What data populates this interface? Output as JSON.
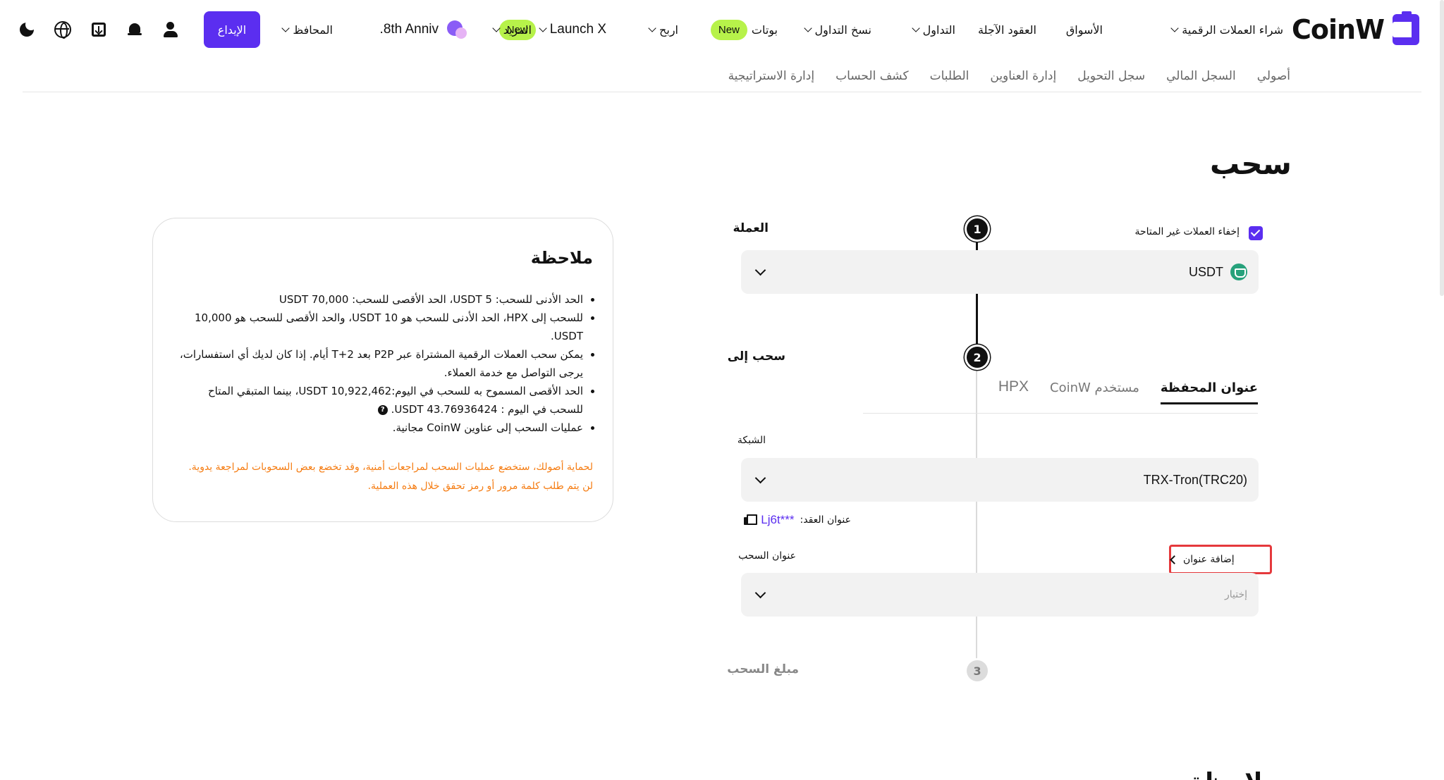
{
  "header": {
    "brand": "CoinW",
    "nav": {
      "buy_crypto": "شراء العملات الرقمية",
      "markets": "الأسواق",
      "futures": "العقود الآجلة",
      "trade": "التداول",
      "copy_trading": "نسخ التداول",
      "bots": "بوتات",
      "new_badge": "New",
      "earn": "اربح",
      "launchx": "Launch X",
      "more": "المزيد",
      "anniversary": "8th Anniv.",
      "wallets": "المحافظ"
    },
    "deposit": "الإيداع"
  },
  "subnav": [
    "أصولي",
    "السجل المالي",
    "سجل التحويل",
    "إدارة العناوين",
    "الطلبات",
    "كشف الحساب",
    "إدارة الاستراتيجية"
  ],
  "page": {
    "title": "سحب"
  },
  "steps": {
    "step1": {
      "number": "1",
      "label": "العملة",
      "hide_unavailable": "إخفاء العملات غير المتاحة",
      "hide_unavailable_checked": true,
      "coin": "USDT"
    },
    "step2": {
      "number": "2",
      "label": "سحب إلى",
      "tabs": [
        "عنوان المحفظة",
        "مستخدم CoinW",
        "HPX"
      ],
      "network_label": "الشبكة",
      "network": "TRX-Tron(TRC20)",
      "contract_label": "عنوان العقد:",
      "contract_address": "Lj6t***",
      "address_label": "عنوان السحب",
      "add_address": "إضافة عنوان",
      "address_placeholder": "إختيار"
    },
    "step3": {
      "number": "3",
      "label": "مبلغ السحب"
    }
  },
  "note": {
    "title": "ملاحظة",
    "items": [
      "الحد الأدنى للسحب: 5 USDT، الحد الأقصى للسحب: 70,000 USDT",
      "للسحب إلى HPX، الحد الأدنى للسحب هو 10 USDT، والحد الأقصى للسحب هو 10,000 USDT.",
      "يمكن سحب العملات الرقمية المشتراة عبر P2P بعد T+2 أيام. إذا كان لديك أي استفسارات، يرجى التواصل مع خدمة العملاء.",
      "الحد الأقصى المسموح به للسحب في اليوم:10,922,462 USDT، بينما المتبقي المتاح للسحب في اليوم : 43.76936424 USDT.",
      "عمليات السحب إلى عناوين CoinW مجانية."
    ],
    "help_icon": "?",
    "warning_lines": [
      "لحماية أصولك، ستخضع عمليات السحب لمراجعات أمنية، وقد تخضع بعض السحوبات لمراجعة يدوية.",
      "لن يتم طلب كلمة مرور أو رمز تحقق خلال هذه العملية."
    ],
    "warning_color": "#f57c12"
  },
  "bottom": {
    "partial_title": "ملاحظة"
  },
  "colors": {
    "accent": "#5b2ef0",
    "new_badge": "#b7f24a",
    "highlight_border": "#e5393c"
  },
  "icons": [
    "moon-icon",
    "globe-icon",
    "download-icon",
    "bell-icon",
    "user-icon",
    "anniversary-icon",
    "usdt-icon",
    "copy-icon"
  ]
}
